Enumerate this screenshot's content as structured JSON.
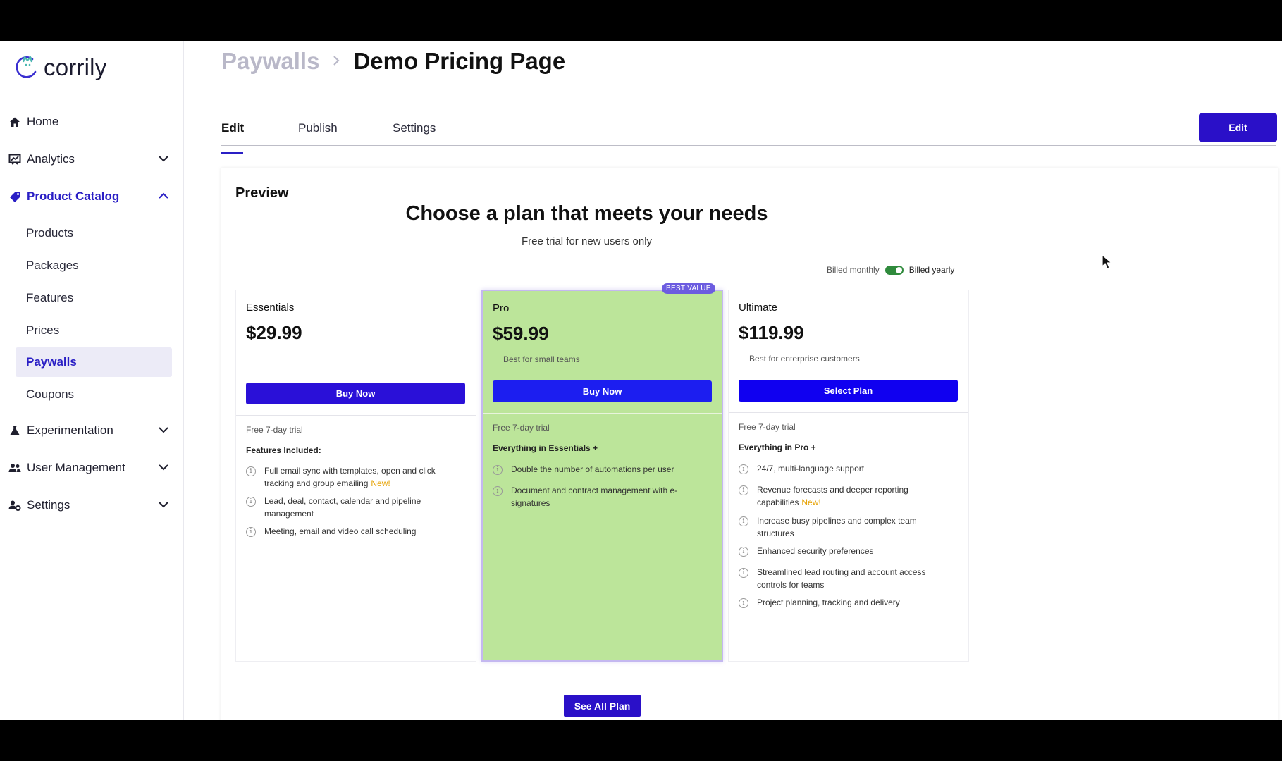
{
  "app": {
    "logo_text": "corrily"
  },
  "sidebar": {
    "home": "Home",
    "analytics": "Analytics",
    "product_catalog": "Product Catalog",
    "sub_items": [
      "Products",
      "Packages",
      "Features",
      "Prices",
      "Paywalls",
      "Coupons"
    ],
    "active_sub_item": "Paywalls",
    "experimentation": "Experimentation",
    "user_management": "User Management",
    "settings": "Settings"
  },
  "header": {
    "breadcrumb_parent": "Paywalls",
    "breadcrumb_current": "Demo Pricing Page"
  },
  "tabs": {
    "edit": "Edit",
    "publish": "Publish",
    "settings": "Settings",
    "active": "Edit"
  },
  "edit_button": "Edit",
  "preview": {
    "label": "Preview",
    "headline": "Choose a plan that meets your needs",
    "subheadline": "Free trial for new users only",
    "billing_monthly": "Billed monthly",
    "billing_yearly": "Billed yearly",
    "billing_selected": "yearly",
    "plans": [
      {
        "name": "Essentials",
        "price": "$29.99",
        "description": "",
        "button": "Buy Now",
        "trial": "Free 7-day trial",
        "features_heading": "Features Included:",
        "features": [
          {
            "text": "Full email sync with templates, open and click tracking and group emailing",
            "tag": "New!"
          },
          {
            "text": "Lead, deal, contact, calendar and pipeline management",
            "tag": ""
          },
          {
            "text": "Meeting, email and video call scheduling",
            "tag": ""
          }
        ]
      },
      {
        "name": "Pro",
        "badge": "BEST VALUE",
        "price": "$59.99",
        "description": "Best for small teams",
        "button": "Buy Now",
        "trial": "Free 7-day trial",
        "features_heading": "Everything in Essentials +",
        "features": [
          {
            "text": "Double the number of automations per user",
            "tag": ""
          },
          {
            "text": "Document and contract management with e-signatures",
            "tag": ""
          }
        ]
      },
      {
        "name": "Ultimate",
        "price": "$119.99",
        "description": "Best for enterprise customers",
        "button": "Select Plan",
        "trial": "Free 7-day trial",
        "features_heading": "Everything in Pro +",
        "features": [
          {
            "text": "24/7, multi-language support",
            "tag": ""
          },
          {
            "text": "Revenue forecasts and deeper reporting capabilities",
            "tag": "New!"
          },
          {
            "text": "Increase busy pipelines and complex team structures",
            "tag": ""
          },
          {
            "text": "Enhanced security preferences",
            "tag": ""
          },
          {
            "text": "Streamlined lead routing and account access controls for teams",
            "tag": ""
          },
          {
            "text": "Project planning, tracking and delivery",
            "tag": ""
          }
        ]
      }
    ],
    "see_all_button": "See All Plan"
  },
  "colors": {
    "brand": "#2a10c8",
    "accent_text": "#2a1fc5",
    "pro_card_bg": "#bce59a",
    "new_tag": "#e6a100",
    "best_value_badge": "#6c5ce0",
    "toggle_on": "#2f8a3c"
  }
}
